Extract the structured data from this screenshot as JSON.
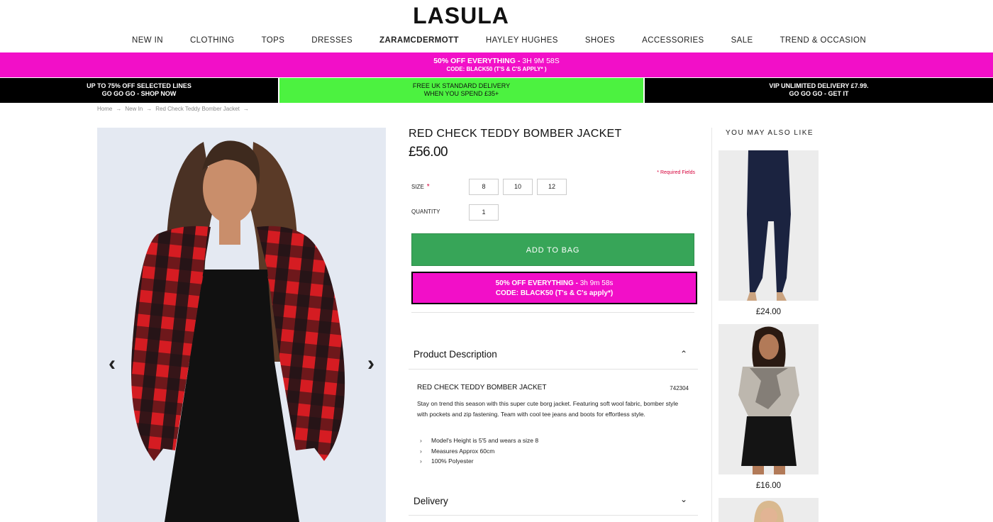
{
  "brand": "LASULA",
  "nav": [
    "NEW IN",
    "CLOTHING",
    "TOPS",
    "DRESSES",
    "ZARAMCDERMOTT",
    "HAYLEY HUGHES",
    "SHOES",
    "ACCESSORIES",
    "SALE",
    "TREND & OCCASION"
  ],
  "promo": {
    "headline": "50% OFF EVERYTHING - ",
    "timer": "3H 9M 58S",
    "code": "CODE: BLACK50 (T'S & C'S APPLY* )"
  },
  "strip": {
    "left_l1": "UP TO 75% OFF SELECTED LINES",
    "left_l2": "GO GO GO - SHOP NOW",
    "mid_l1": "FREE UK STANDARD DELIVERY",
    "mid_l2": "WHEN YOU SPEND £35+",
    "right_l1": "VIP UNLIMITED DELIVERY £7.99.",
    "right_l2": "GO GO GO - GET IT"
  },
  "breadcrumbs": [
    "Home",
    "New In",
    "Red Check Teddy Bomber Jacket"
  ],
  "product": {
    "title": "RED CHECK TEDDY BOMBER JACKET",
    "price": "£56.00",
    "required_note": "* Required Fields",
    "size_label": "SIZE",
    "sizes": [
      "8",
      "10",
      "12"
    ],
    "quantity_label": "QUANTITY",
    "quantity": "1",
    "add_to_bag": "ADD TO BAG",
    "promo_l1": "50% OFF EVERYTHING - ",
    "promo_timer": "3h 9m 58s",
    "promo_l2": "CODE: BLACK50 (T's & C's apply*)"
  },
  "description": {
    "heading": "Product Description",
    "title": "RED CHECK TEDDY BOMBER JACKET",
    "code": "742304",
    "body": "Stay on trend this season with this super cute borg jacket. Featuring soft wool fabric, bomber style with pockets and zip fastening. Team with cool tee jeans and boots for effortless style.",
    "bullets": [
      "Model's Height is 5'5 and wears a size 8",
      "Measures Approx 60cm",
      "100% Polyester"
    ]
  },
  "delivery": {
    "heading": "Delivery"
  },
  "sidebar": {
    "heading": "YOU MAY ALSO LIKE",
    "items": [
      {
        "price": "£24.00"
      },
      {
        "price": "£16.00"
      }
    ]
  },
  "colors": {
    "pink": "#f20fc8",
    "green_banner": "#4cf240",
    "add_to_bag": "#37a558"
  }
}
